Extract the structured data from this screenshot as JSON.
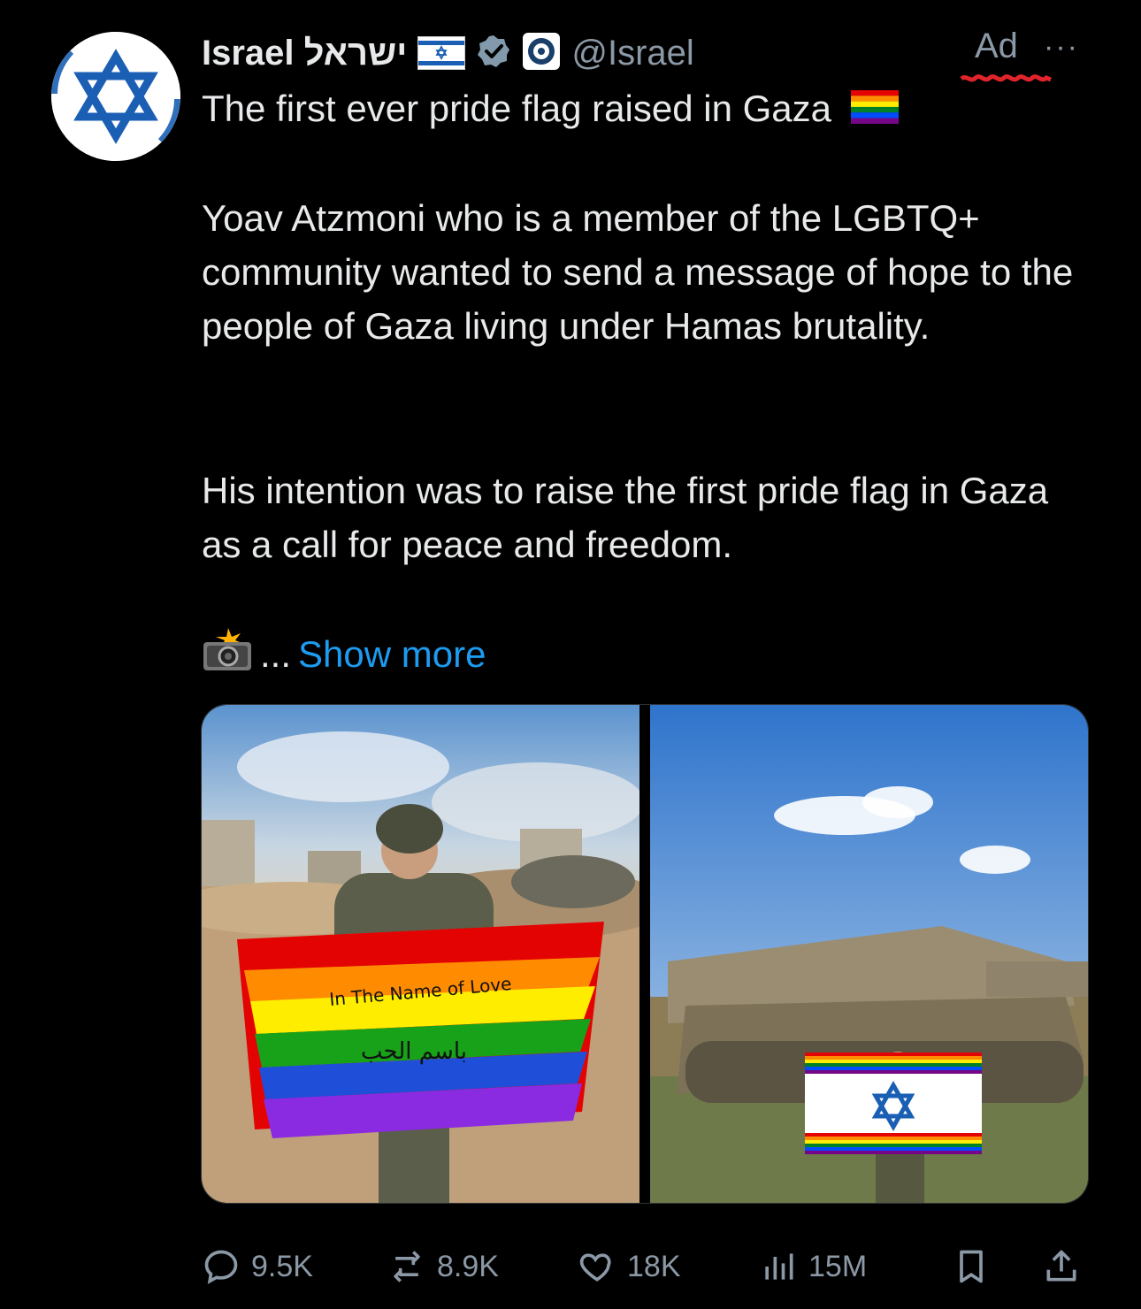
{
  "account": {
    "name": "Israel ישראל",
    "handle": "@Israel",
    "ad_label": "Ad",
    "more_label": "···"
  },
  "tweet": {
    "paragraphs": [
      "The first ever pride flag raised in Gaza",
      "Yoav Atzmoni who is a member of the LGBTQ+ community wanted to send a message of hope to the people of Gaza living under Hamas brutality.",
      "His intention was to raise the first pride flag in Gaza as a call for peace and freedom."
    ],
    "ellipsis": "...",
    "show_more": "Show more"
  },
  "media": {
    "left_flag_text_line1": "In The Name of Love",
    "left_flag_text_line2": "باسم الحب"
  },
  "actions": {
    "replies": "9.5K",
    "reposts": "8.9K",
    "likes": "18K",
    "views": "15M"
  },
  "colors": {
    "accent": "#1d9bf0",
    "muted": "#8b98a5",
    "text": "#e7e9ea",
    "background": "#000000"
  }
}
